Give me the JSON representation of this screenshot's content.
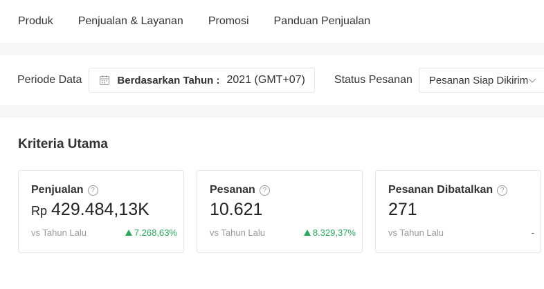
{
  "nav": {
    "items": [
      "Produk",
      "Penjualan & Layanan",
      "Promosi",
      "Panduan Penjualan"
    ]
  },
  "filters": {
    "period_label": "Periode Data",
    "date_prefix": "Berdasarkan Tahun :",
    "date_value": "2021 (GMT+07)",
    "status_label": "Status Pesanan",
    "status_value": "Pesanan Siap Dikirim"
  },
  "main": {
    "title": "Kriteria Utama",
    "cards": [
      {
        "title": "Penjualan",
        "prefix": "Rp",
        "value": "429.484,13K",
        "compare": "vs Tahun Lalu",
        "change": "7.268,63%"
      },
      {
        "title": "Pesanan",
        "prefix": "",
        "value": "10.621",
        "compare": "vs Tahun Lalu",
        "change": "8.329,37%"
      },
      {
        "title": "Pesanan Dibatalkan",
        "prefix": "",
        "value": "271",
        "compare": "vs Tahun Lalu",
        "change": "-"
      }
    ]
  },
  "colors": {
    "positive": "#26aa5a",
    "border": "#e5e5e5",
    "background": "#f6f6f6"
  },
  "icons": {
    "calendar": "calendar-icon",
    "chevron": "chevron-down-icon",
    "help": "help-icon",
    "trend_up": "arrow-up-icon"
  }
}
